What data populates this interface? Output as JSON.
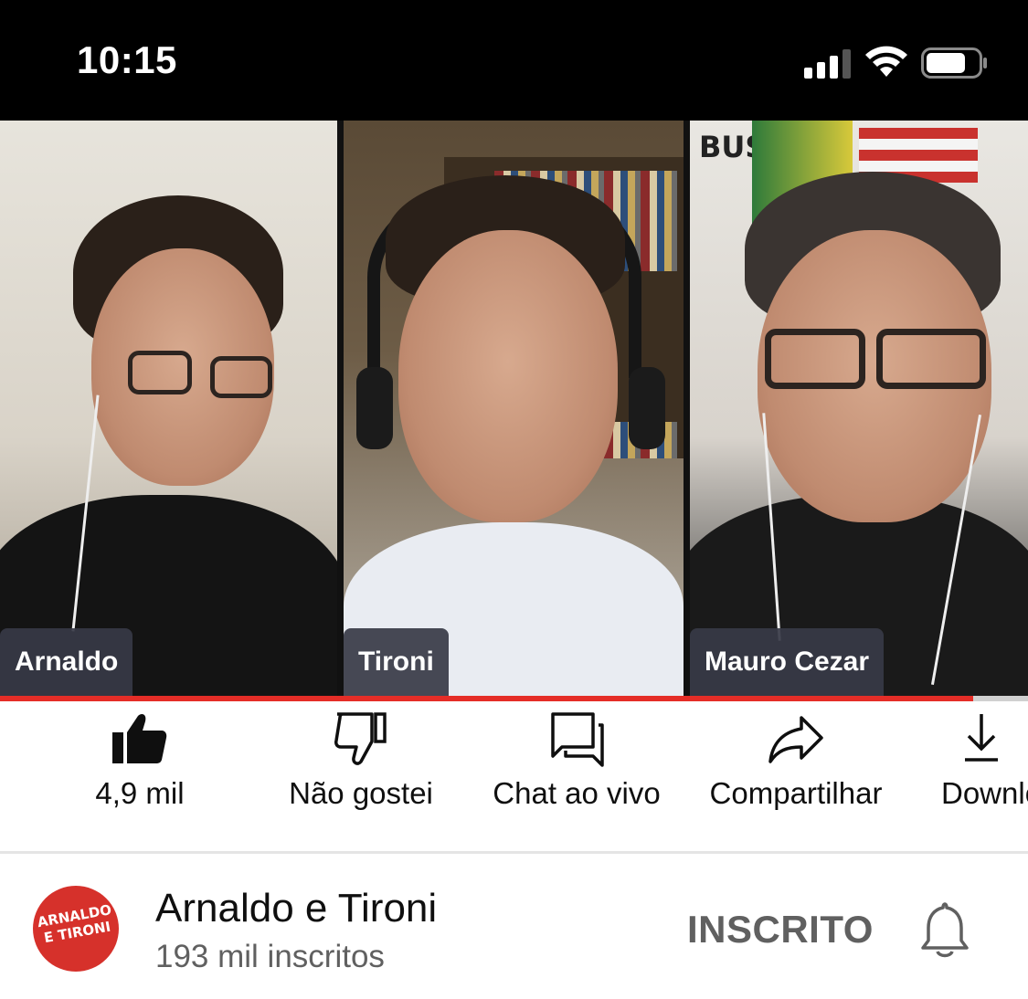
{
  "status_bar": {
    "time": "10:15"
  },
  "video": {
    "participants": [
      {
        "name": "Arnaldo"
      },
      {
        "name": "Tironi"
      },
      {
        "name": "Mauro Cezar"
      }
    ],
    "progress_fraction": 0.947
  },
  "actions": [
    {
      "icon": "thumbs-up-icon",
      "label": "4,9 mil"
    },
    {
      "icon": "thumbs-down-icon",
      "label": "Não gostei"
    },
    {
      "icon": "chat-icon",
      "label": "Chat ao vivo"
    },
    {
      "icon": "share-icon",
      "label": "Compartilhar"
    },
    {
      "icon": "download-icon",
      "label": "Download"
    }
  ],
  "channel": {
    "logo_text": "ARNALDO E TIRONI",
    "name": "Arnaldo e Tironi",
    "subscribers": "193 mil inscritos",
    "subscribe_state": "INSCRITO"
  },
  "colors": {
    "accent_red": "#e52d27",
    "status_bar_bg": "#000000"
  }
}
